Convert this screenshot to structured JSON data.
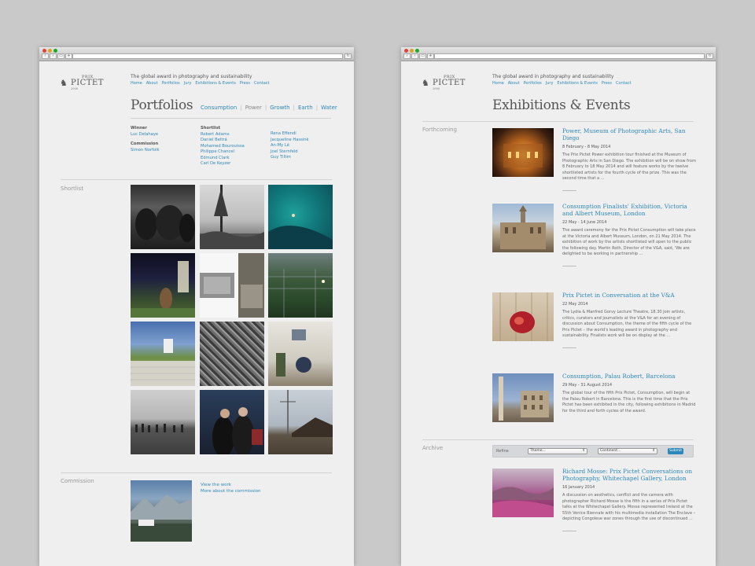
{
  "site": {
    "logo_prix": "PRIX",
    "logo_main": "PICTET",
    "logo_date": "2008",
    "tagline": "The global award in photography and sustainability",
    "nav": [
      "Home",
      "About",
      "Portfolios",
      "Jury",
      "Exhibitions & Events",
      "Press",
      "Contact"
    ]
  },
  "portfolios": {
    "title": "Portfolios",
    "subnav": [
      "Consumption",
      "Power",
      "Growth",
      "Earth",
      "Water"
    ],
    "winner_label": "Winner",
    "winner": "Luc Delahaye",
    "commission_label": "Commission",
    "commission": "Simon Norfolk",
    "shortlist_label": "Shortlist",
    "shortlist_col1": [
      "Robert Adams",
      "Daniel Beltrá",
      "Mohamed Bourouissa",
      "Philippe Chancel",
      "Edmund Clark",
      "Carl De Keyzer"
    ],
    "shortlist_col2": [
      "Rena Effendi",
      "Jacqueline Hassink",
      "An-My Lê",
      "Joel Sternfeld",
      "Guy Tillim"
    ],
    "section_shortlist": "Shortlist",
    "section_commission": "Commission",
    "commission_links": [
      "View the work",
      "More about the commission"
    ]
  },
  "exhibitions": {
    "title": "Exhibitions & Events",
    "forthcoming_label": "Forthcoming",
    "archive_label": "Archive",
    "refine": {
      "label": "Refine",
      "theme_placeholder": "Theme...",
      "continent_placeholder": "Continent...",
      "submit": "Submit"
    },
    "events": [
      {
        "title": "Power, Museum of Photographic Arts, San Diego",
        "date": "8 February - 8 May 2014",
        "desc": "The Prix Pictet Power exhibition tour finished at the Museum of Photographic Arts in San Diego. The exhibition will be on show from 8 February to 18 May 2014 and will feature works by the twelve shortlisted artists for the fourth cycle of the prize. This was the second time that a ..."
      },
      {
        "title": "Consumption Finalists' Exhibition, Victoria and Albert Museum, London",
        "date": "22 May - 14 June 2014",
        "desc": "The award ceremony for the Prix Pictet Consumption will take place at the Victoria and Albert Museum, London, on 21 May 2014. The exhibition of work by the artists shortlisted will open to the public the following day. Martin Roth, Director of the V&A, said, 'We are delighted to be working in partnership ..."
      },
      {
        "title": "Prix Pictet in Conversation at the V&A",
        "date": "22 May 2014",
        "desc": "The Lydia & Manfred Gorvy Lecture Theatre, 18.30 Join artists, critics, curators and journalists at the V&A for an evening of discussion about Consumption, the theme of the fifth cycle of the Prix Pictet – the world's leading award in photography and sustainability. Finalists work will be on display at the ..."
      },
      {
        "title": "Consumption, Palau Robert, Barcelona",
        "date": "29 May - 31 August 2014",
        "desc": "The global tour of the fifth Prix Pictet, Consumption, will begin at the Palau Robert in Barcelona. This is the first time that the Prix Pictet has been exhibited in the city, following exhibitions in Madrid for the third and forth cycles of the award."
      }
    ],
    "archive_events": [
      {
        "title": "Richard Mosse: Prix Pictet Conversations on Photography, Whitechapel Gallery, London",
        "date": "16 January 2014",
        "desc": "A discussion on aesthetics, conflict and the camera with photographer Richard Mosse is the fifth in a series of Prix Pictet talks at the Whitechapel Gallery. Mosse represented Ireland at the 55th Venice Biennale with his multimedia installation The Enclave – depicting Congolese war zones through the use of discontinued ..."
      }
    ]
  }
}
